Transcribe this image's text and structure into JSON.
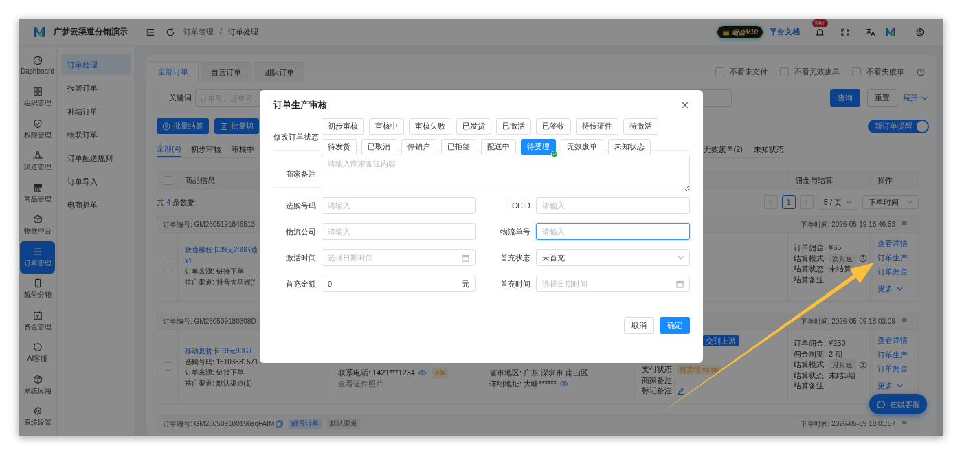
{
  "app": {
    "name": "广梦云渠道分销演示"
  },
  "header": {
    "breadcrumb": {
      "items": [
        "订单管理",
        "订单处理"
      ],
      "separator": "/"
    },
    "vip_badge": "超会V10",
    "docs_link": "平台文档",
    "notification_count": "99+"
  },
  "rail": [
    {
      "label": "Dashboard",
      "selected": false
    },
    {
      "label": "组织管理",
      "selected": false
    },
    {
      "label": "权限管理",
      "selected": false
    },
    {
      "label": "渠道管理",
      "selected": false
    },
    {
      "label": "商品管理",
      "selected": false
    },
    {
      "label": "物联中台",
      "selected": false
    },
    {
      "label": "订单管理",
      "selected": true
    },
    {
      "label": "靓号分销",
      "selected": false
    },
    {
      "label": "资金管理",
      "selected": false
    },
    {
      "label": "AI客服",
      "selected": false
    },
    {
      "label": "系统应用",
      "selected": false
    },
    {
      "label": "系统设置",
      "selected": false
    }
  ],
  "submenu": [
    {
      "label": "订单处理",
      "selected": true
    },
    {
      "label": "报警订单",
      "selected": false
    },
    {
      "label": "补结订单",
      "selected": false
    },
    {
      "label": "物联订单",
      "selected": false
    },
    {
      "label": "订单配送规则",
      "selected": false
    },
    {
      "label": "订单导入",
      "selected": false
    },
    {
      "label": "电商抓单",
      "selected": false
    }
  ],
  "order_tabs": [
    {
      "label": "全部订单",
      "selected": true
    },
    {
      "label": "自营订单",
      "selected": false
    },
    {
      "label": "团队订单",
      "selected": false
    }
  ],
  "filters": [
    {
      "label": "不看未支付",
      "checked": false
    },
    {
      "label": "不看无效废单",
      "checked": false
    },
    {
      "label": "不看失败单",
      "checked": false
    }
  ],
  "search": {
    "label": "关键词",
    "placeholder": "订单号、运单号、"
  },
  "actions": {
    "query": "查询",
    "reset": "重置",
    "expand": "展开"
  },
  "batch_buttons": [
    "批量结算",
    "批量切"
  ],
  "new_order_alert": {
    "label": "新订单提醒",
    "on": true
  },
  "status_tabs": {
    "start": [
      {
        "label": "全部(4)",
        "selected": true
      },
      {
        "label": "初步审核",
        "selected": false
      },
      {
        "label": "审核中",
        "selected": false
      }
    ],
    "end": [
      {
        "label": "无效废单(2)",
        "selected": false
      },
      {
        "label": "未知状态",
        "selected": false
      }
    ]
  },
  "table": {
    "select_all_checked": false,
    "columns": {
      "product": "商品信息",
      "commission": "佣金与结算",
      "actions": "操作"
    },
    "count": {
      "prefix": "共",
      "value": "4",
      "suffix": "条数据"
    }
  },
  "pagination": {
    "page": "1",
    "page_size": "5 / 页",
    "sort": "下单时间"
  },
  "orders": [
    {
      "order_no": "订单编号: GM2605191846513",
      "time": "下单时间: 2026-05-19 18:46:53",
      "checked": false,
      "product": {
        "title": "联通柳枝卡39元280G通",
        "quantity": "x1",
        "lines": [
          "订单来源: 链接下单",
          "推广渠道: 抖音大马猴(f"
        ]
      },
      "commission": [
        {
          "kind": "text",
          "label": "订单佣金:",
          "value": "¥65"
        },
        {
          "kind": "tag",
          "label": "结算模式:",
          "value": "次月返"
        },
        {
          "kind": "text",
          "label": "结算状态:",
          "value": "未结算"
        },
        {
          "kind": "text",
          "label": "结算备注:"
        }
      ],
      "ops": {
        "links": [
          "查看详情",
          "订单生产",
          "订单佣金"
        ],
        "more": "更多"
      }
    },
    {
      "order_no": "订单编号: GM260509180308D",
      "time": "下单时间: 2026-05-09 18:03:09",
      "checked": false,
      "product": {
        "title": "移动夏哲卡 19元90G+",
        "lines": [
          "选购号码: 15103831571",
          "订单来源: 链接下单",
          "推广渠道: 默认渠道(1)"
        ]
      },
      "contact": {
        "phone": "联系电话: 1421***1234",
        "tag": "2单",
        "photo_link": "查看证件照片"
      },
      "region": {
        "area": "省市地区: 广东 深圳市 南山区",
        "address": "详细地址: 大崃******"
      },
      "payment": {
        "badge": "交到上游",
        "status_label": "支付状态:",
        "status": "待支付 ¥9.90",
        "merchant_note": "商家备注:",
        "mark_note": "标记备注:"
      },
      "commission": [
        {
          "kind": "text",
          "label": "订单佣金:",
          "value": "¥230"
        },
        {
          "kind": "text",
          "label": "佣金周期:",
          "value": "2 期"
        },
        {
          "kind": "tag",
          "label": "结算模式:",
          "value": "月月返"
        },
        {
          "kind": "text",
          "label": "结算状态:",
          "value": "未结3期"
        },
        {
          "kind": "text",
          "label": "结算备注:"
        }
      ],
      "ops": {
        "links": [
          "查看详情",
          "订单生产",
          "订单佣金"
        ],
        "more": "更多"
      }
    },
    {
      "order_no": "订单编号: GM260509180156sqFAIM",
      "tags": [
        {
          "kind": "primary",
          "label": "靓号订单"
        },
        {
          "kind": "default",
          "label": "默认渠道"
        }
      ],
      "time": "下单时间: 2026-05-09 18:01:57"
    }
  ],
  "support_button": "在线客服",
  "modal": {
    "title": "订单生产审核",
    "status_label": "修改订单状态",
    "statuses": [
      {
        "label": "初步审核",
        "selected": false
      },
      {
        "label": "审核中",
        "selected": false
      },
      {
        "label": "审核失败",
        "selected": false
      },
      {
        "label": "已发货",
        "selected": false
      },
      {
        "label": "已激活",
        "selected": false
      },
      {
        "label": "已签收",
        "selected": false
      },
      {
        "label": "待传证件",
        "selected": false
      },
      {
        "label": "待激活",
        "selected": false
      },
      {
        "label": "待发货",
        "selected": false
      },
      {
        "label": "已取消",
        "selected": false
      },
      {
        "label": "停销户",
        "selected": false
      },
      {
        "label": "已拒签",
        "selected": false
      },
      {
        "label": "配送中",
        "selected": false
      },
      {
        "label": "待受理",
        "selected": true
      },
      {
        "label": "无效废单",
        "selected": false
      },
      {
        "label": "未知状态",
        "selected": false
      }
    ],
    "note": {
      "label": "商家备注",
      "placeholder": "请输入商家备注内容"
    },
    "fields": [
      {
        "label": "选购号码",
        "kind": "text",
        "placeholder": "请输入",
        "focused": false
      },
      {
        "label": "ICCID",
        "kind": "text",
        "placeholder": "请输入",
        "focused": false
      },
      {
        "label": "物流公司",
        "kind": "text",
        "placeholder": "请输入",
        "focused": false
      },
      {
        "label": "物流单号",
        "kind": "text",
        "placeholder": "请输入",
        "focused": true
      },
      {
        "label": "激活时间",
        "kind": "datetime",
        "placeholder": "选择日期时间"
      },
      {
        "label": "首充状态",
        "kind": "select",
        "value": "未首充"
      },
      {
        "label": "首充金额",
        "kind": "amount",
        "value": "0",
        "suffix": "元"
      },
      {
        "label": "首充时间",
        "kind": "datetime",
        "placeholder": "选择日期时间"
      }
    ],
    "buttons": {
      "cancel": "取消",
      "confirm": "确定"
    }
  }
}
